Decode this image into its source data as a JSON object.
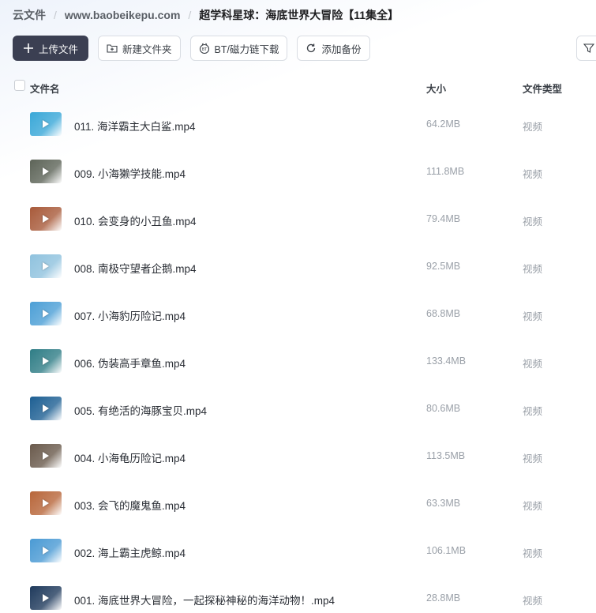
{
  "breadcrumb": {
    "root": "云文件",
    "site": "www.baobeikepu.com",
    "current": "超学科星球：海底世界大冒险【11集全】"
  },
  "toolbar": {
    "upload": "上传文件",
    "new_folder": "新建文件夹",
    "bt_download": "BT/磁力链下载",
    "add_backup": "添加备份"
  },
  "table": {
    "col_name": "文件名",
    "col_size": "大小",
    "col_type": "文件类型"
  },
  "files": [
    {
      "name": "011. 海洋霸主大白鲨.mp4",
      "size": "64.2MB",
      "type": "视频",
      "thumb_color": "#3aa8d8"
    },
    {
      "name": "009. 小海獭学技能.mp4",
      "size": "111.8MB",
      "type": "视频",
      "thumb_color": "#5d6458"
    },
    {
      "name": "010. 会变身的小丑鱼.mp4",
      "size": "79.4MB",
      "type": "视频",
      "thumb_color": "#a85a3a"
    },
    {
      "name": "008. 南极守望者企鹅.mp4",
      "size": "92.5MB",
      "type": "视频",
      "thumb_color": "#8fc2de"
    },
    {
      "name": "007. 小海豹历险记.mp4",
      "size": "68.8MB",
      "type": "视频",
      "thumb_color": "#4c9fd6"
    },
    {
      "name": "006. 伪装高手章鱼.mp4",
      "size": "133.4MB",
      "type": "视频",
      "thumb_color": "#2f7d86"
    },
    {
      "name": "005. 有绝活的海豚宝贝.mp4",
      "size": "80.6MB",
      "type": "视频",
      "thumb_color": "#1d5f93"
    },
    {
      "name": "004. 小海龟历险记.mp4",
      "size": "113.5MB",
      "type": "视频",
      "thumb_color": "#6a5a4c"
    },
    {
      "name": "003. 会飞的魔鬼鱼.mp4",
      "size": "63.3MB",
      "type": "视频",
      "thumb_color": "#b8663a"
    },
    {
      "name": "002. 海上霸主虎鲸.mp4",
      "size": "106.1MB",
      "type": "视频",
      "thumb_color": "#4a9ad4"
    },
    {
      "name": "001. 海底世界大冒险，一起探秘神秘的海洋动物！.mp4",
      "size": "28.8MB",
      "type": "视频",
      "thumb_color": "#1f3a5c"
    }
  ]
}
